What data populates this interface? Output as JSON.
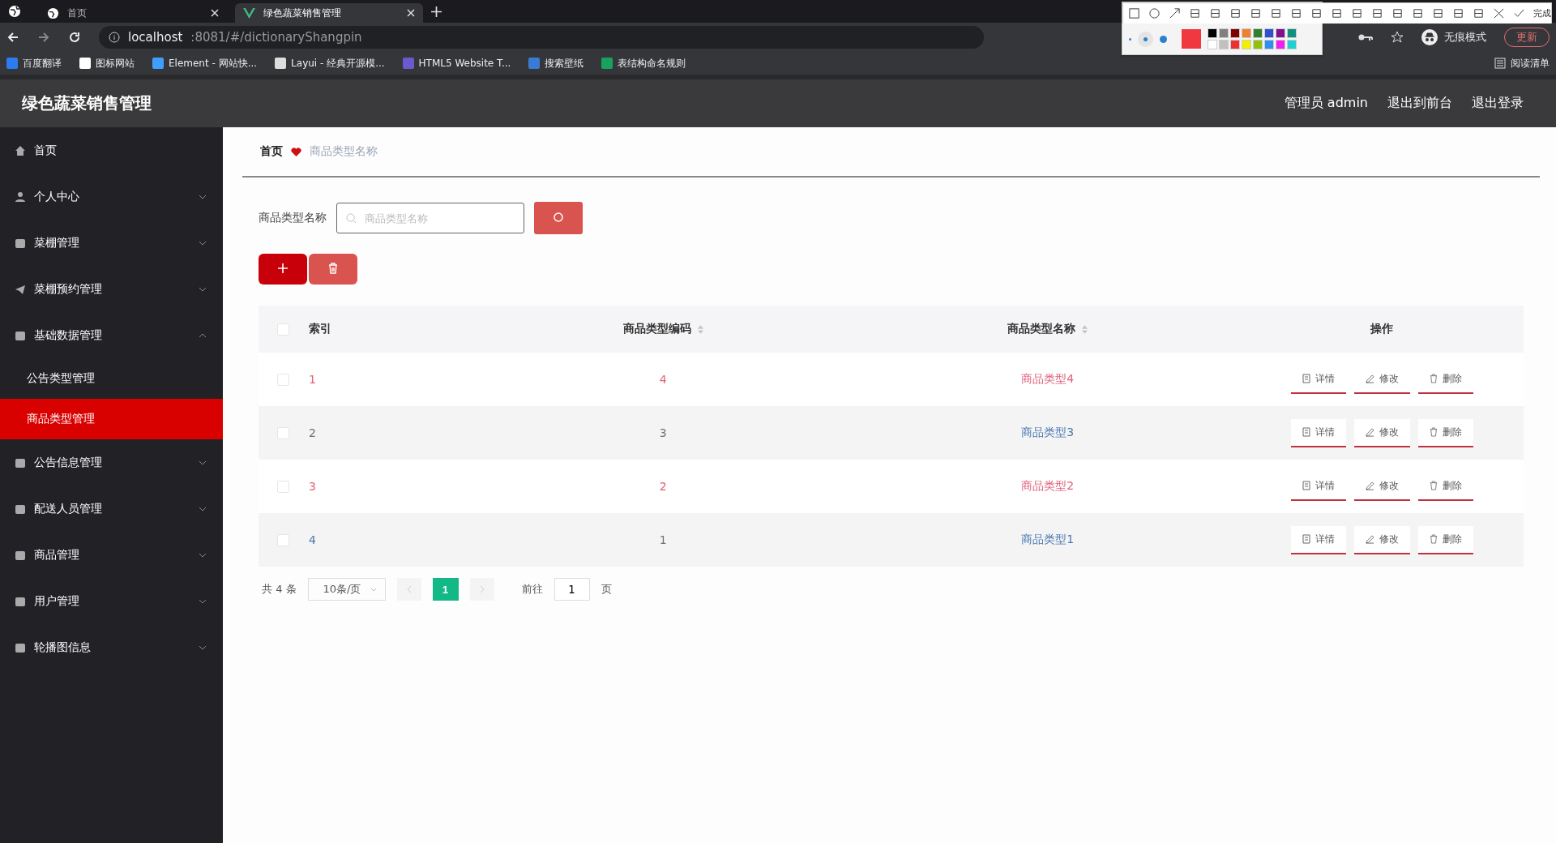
{
  "browser": {
    "tabs": [
      {
        "title": "首页",
        "selected": false
      },
      {
        "title": "绿色蔬菜销售管理",
        "selected": true
      }
    ],
    "address": {
      "host": "localhost",
      "rest": ":8081/#/dictionaryShangpin"
    },
    "bookmarks": [
      {
        "label": "百度翻译",
        "color": "#2b7cf0"
      },
      {
        "label": "图标网站",
        "color": "#ffffff"
      },
      {
        "label": "Element - 网站快...",
        "color": "#409eff"
      },
      {
        "label": "Layui - 经典开源模...",
        "color": "#dddddd"
      },
      {
        "label": "HTML5 Website T...",
        "color": "#6a5acd"
      },
      {
        "label": "搜索壁纸",
        "color": "#3a7bd5"
      },
      {
        "label": "表结构命名规则",
        "color": "#19a15f"
      }
    ],
    "incognito": "无痕模式",
    "update": "更新",
    "reading_list": "阅读清单"
  },
  "capture_toolbar": {
    "done": "完成",
    "swatches": [
      {
        "color": "#000000"
      },
      {
        "color": "#808080"
      },
      {
        "color": "#800000"
      },
      {
        "color": "#f08030"
      },
      {
        "color": "#308030"
      },
      {
        "color": "#3050d0"
      },
      {
        "color": "#801090"
      },
      {
        "color": "#109080"
      },
      {
        "color": "#ffffff"
      },
      {
        "color": "#c0c0c0"
      },
      {
        "color": "#f03030"
      },
      {
        "color": "#f0f000"
      },
      {
        "color": "#90c010"
      },
      {
        "color": "#3090f0"
      },
      {
        "color": "#f020f0"
      },
      {
        "color": "#20d0d0"
      }
    ]
  },
  "header": {
    "title": "绿色蔬菜销售管理",
    "links": [
      "管理员 admin",
      "退出到前台",
      "退出登录"
    ]
  },
  "sidebar": {
    "items": [
      {
        "label": "首页"
      },
      {
        "label": "个人中心",
        "expanded": false
      },
      {
        "label": "菜棚管理",
        "expanded": false
      },
      {
        "label": "菜棚预约管理",
        "expanded": false
      },
      {
        "label": "基础数据管理",
        "expanded": true,
        "children": [
          {
            "label": "公告类型管理",
            "selected": false
          },
          {
            "label": "商品类型管理",
            "selected": true
          }
        ]
      },
      {
        "label": "公告信息管理",
        "expanded": false
      },
      {
        "label": "配送人员管理",
        "expanded": false
      },
      {
        "label": "商品管理",
        "expanded": false
      },
      {
        "label": "用户管理",
        "expanded": false
      },
      {
        "label": "轮播图信息",
        "expanded": false
      }
    ]
  },
  "breadcrumb": [
    "首页",
    "商品类型名称"
  ],
  "search": {
    "label": "商品类型名称",
    "placeholder": "商品类型名称"
  },
  "table": {
    "select_all": {
      "checked": false
    },
    "columns": [
      "索引",
      "商品类型编码",
      "商品类型名称",
      "操作"
    ],
    "rows": [
      {
        "checked": false,
        "cells": [
          {
            "text": "1",
            "color": "#e0607a"
          },
          {
            "text": "4",
            "color": "#e0607a"
          },
          {
            "text": "商品类型4",
            "color": "#e0607a"
          }
        ],
        "actions": [
          "详情",
          "修改",
          "删除"
        ]
      },
      {
        "checked": false,
        "cells": [
          {
            "text": "2",
            "color": "#707070"
          },
          {
            "text": "3",
            "color": "#707070"
          },
          {
            "text": "商品类型3",
            "color": "#4a78b0"
          }
        ],
        "actions": [
          "详情",
          "修改",
          "删除"
        ]
      },
      {
        "checked": false,
        "cells": [
          {
            "text": "3",
            "color": "#e0607a"
          },
          {
            "text": "2",
            "color": "#e0607a"
          },
          {
            "text": "商品类型2",
            "color": "#e0607a"
          }
        ],
        "actions": [
          "详情",
          "修改",
          "删除"
        ]
      },
      {
        "checked": false,
        "cells": [
          {
            "text": "4",
            "color": "#4a78b0"
          },
          {
            "text": "1",
            "color": "#707070"
          },
          {
            "text": "商品类型1",
            "color": "#4a78b0"
          }
        ],
        "actions": [
          "详情",
          "修改",
          "删除"
        ]
      }
    ]
  },
  "pagination": {
    "total": "共 4 条",
    "page_size": "10条/页",
    "pages": [
      {
        "label": "1",
        "selected": true
      }
    ],
    "goto_label": "前往",
    "goto_value": "1",
    "goto_suffix": "页"
  }
}
